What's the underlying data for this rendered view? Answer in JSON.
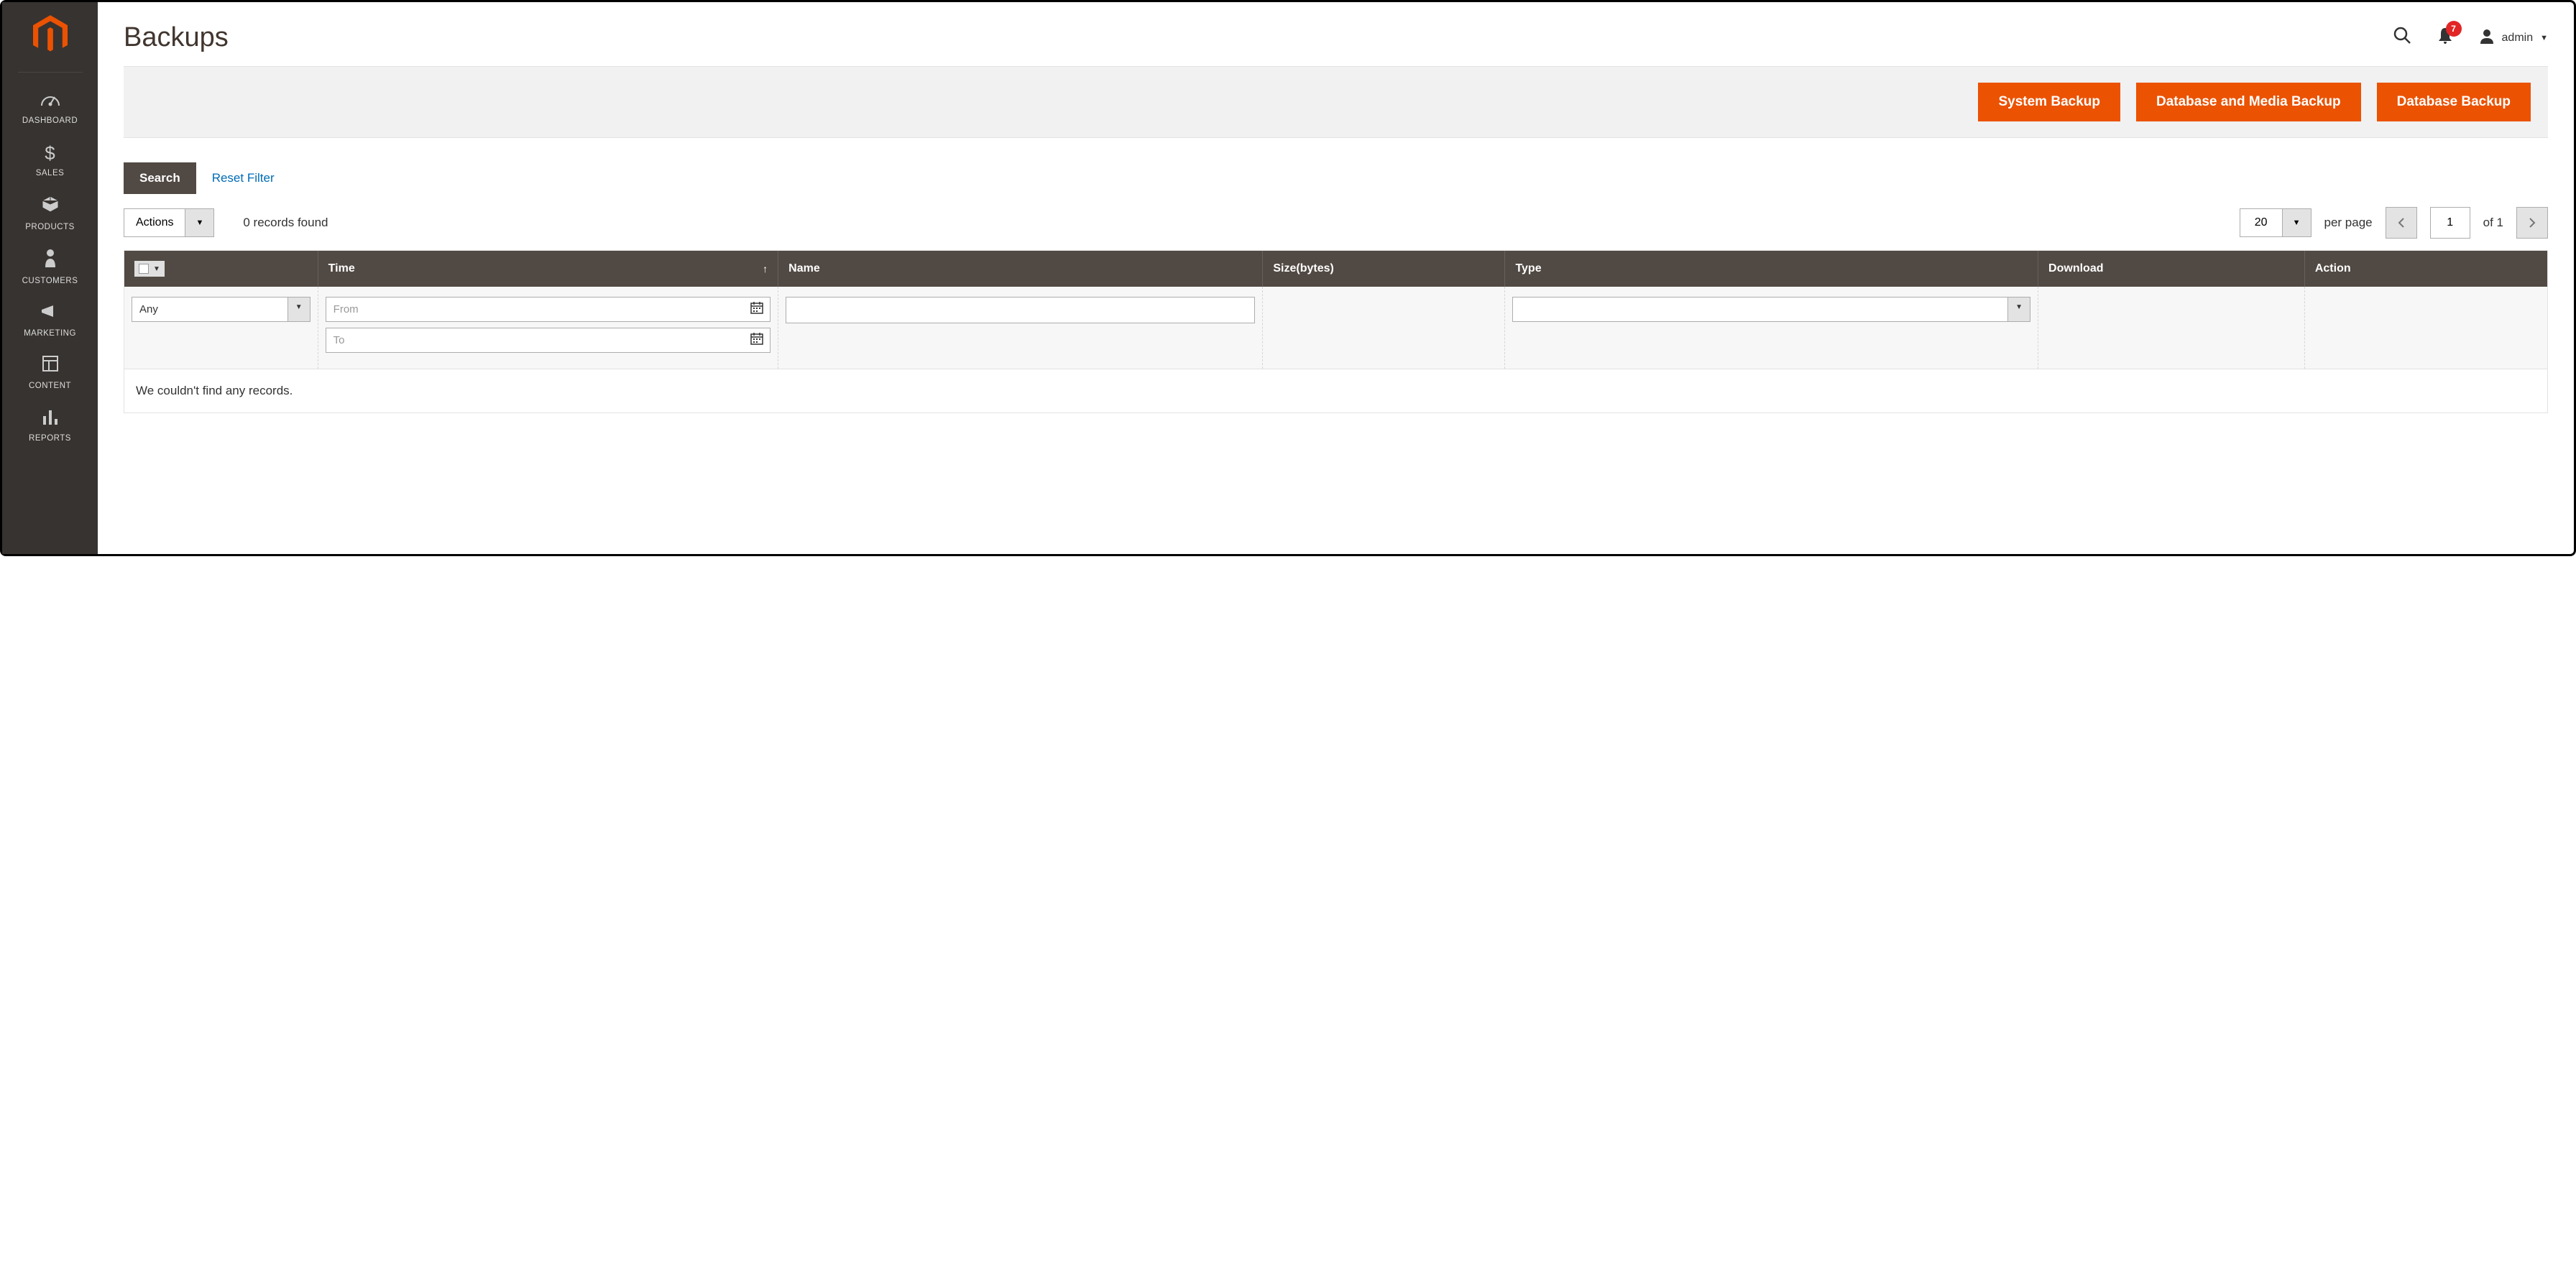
{
  "sidebar": {
    "items": [
      {
        "label": "DASHBOARD"
      },
      {
        "label": "SALES"
      },
      {
        "label": "PRODUCTS"
      },
      {
        "label": "CUSTOMERS"
      },
      {
        "label": "MARKETING"
      },
      {
        "label": "CONTENT"
      },
      {
        "label": "REPORTS"
      }
    ]
  },
  "header": {
    "title": "Backups",
    "notification_count": "7",
    "user": "admin"
  },
  "actions": {
    "system_backup": "System Backup",
    "db_media_backup": "Database and Media Backup",
    "db_backup": "Database Backup"
  },
  "filter": {
    "search_label": "Search",
    "reset_label": "Reset Filter",
    "actions_label": "Actions",
    "records_found": "0 records found",
    "page_size": "20",
    "per_page_label": "per page",
    "current_page": "1",
    "of_total": "of 1"
  },
  "grid": {
    "columns": {
      "time": "Time",
      "name": "Name",
      "size": "Size(bytes)",
      "type": "Type",
      "download": "Download",
      "action": "Action"
    },
    "filters": {
      "any": "Any",
      "from_placeholder": "From",
      "to_placeholder": "To"
    },
    "empty": "We couldn't find any records."
  }
}
